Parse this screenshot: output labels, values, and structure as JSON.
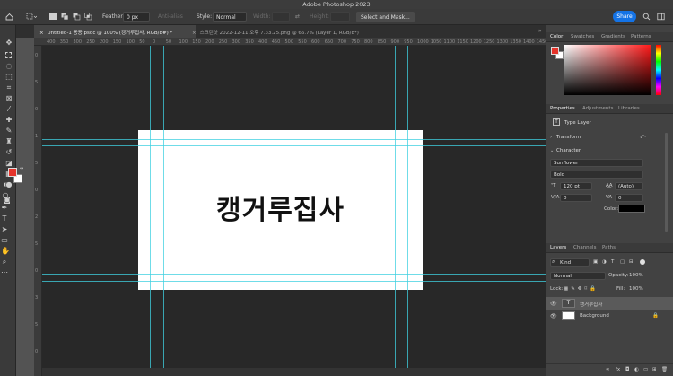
{
  "window": {
    "title": "Adobe Photoshop 2023"
  },
  "options_bar": {
    "feather_label": "Feather:",
    "feather_value": "0 px",
    "anti_alias_label": "Anti-alias",
    "style_label": "Style:",
    "style_value": "Normal",
    "width_label": "Width:",
    "height_label": "Height:",
    "select_mask_label": "Select and Mask...",
    "share_label": "Share"
  },
  "tabs": [
    {
      "label": "Untitled-1 응용.psdc @ 100% (캥거루집사, RGB/8#) *",
      "active": true
    },
    {
      "label": "스크린샷 2022-12-11 오후 7.33.25.png @ 66.7% (Layer 1, RGB/8*)",
      "active": false
    }
  ],
  "ruler_top": [
    "400",
    "350",
    "300",
    "250",
    "200",
    "150",
    "100",
    "50",
    "0",
    "50",
    "100",
    "150",
    "200",
    "250",
    "300",
    "350",
    "400",
    "450",
    "500",
    "550",
    "600",
    "650",
    "700",
    "750",
    "800",
    "850",
    "900",
    "950",
    "1000",
    "1050",
    "1100",
    "1150",
    "1200",
    "1250",
    "1300",
    "1350",
    "1400",
    "1450",
    "1500"
  ],
  "ruler_left": [
    "0",
    "5",
    "0",
    "1",
    "5",
    "0",
    "2",
    "5",
    "0",
    "3",
    "5",
    "0"
  ],
  "canvas": {
    "text": "캥거루집사"
  },
  "color_panel": {
    "tabs": [
      "Color",
      "Swatches",
      "Gradients",
      "Patterns"
    ]
  },
  "properties_panel": {
    "tabs": [
      "Properties",
      "Adjustments",
      "Libraries"
    ],
    "type_layer_label": "Type Layer",
    "transform_label": "Transform",
    "character_label": "Character",
    "font_family": "Sunflower",
    "font_style": "Bold",
    "font_size": "120 pt",
    "leading": "(Auto)",
    "kerning": "0",
    "tracking": "0",
    "color_label": "Color:"
  },
  "layers_panel": {
    "tabs": [
      "Layers",
      "Channels",
      "Paths"
    ],
    "filter_kind": "Kind",
    "blend_mode": "Normal",
    "opacity_label": "Opacity:",
    "opacity_value": "100%",
    "lock_label": "Lock:",
    "fill_label": "Fill:",
    "fill_value": "100%",
    "layers": [
      {
        "name": "캥거루집사",
        "type": "text",
        "selected": true
      },
      {
        "name": "Background",
        "type": "pixel",
        "selected": false
      }
    ]
  },
  "colors": {
    "foreground": "#e5342b",
    "background": "#ffffff",
    "accent": "#1473e6",
    "guide": "#3fd0e0"
  }
}
